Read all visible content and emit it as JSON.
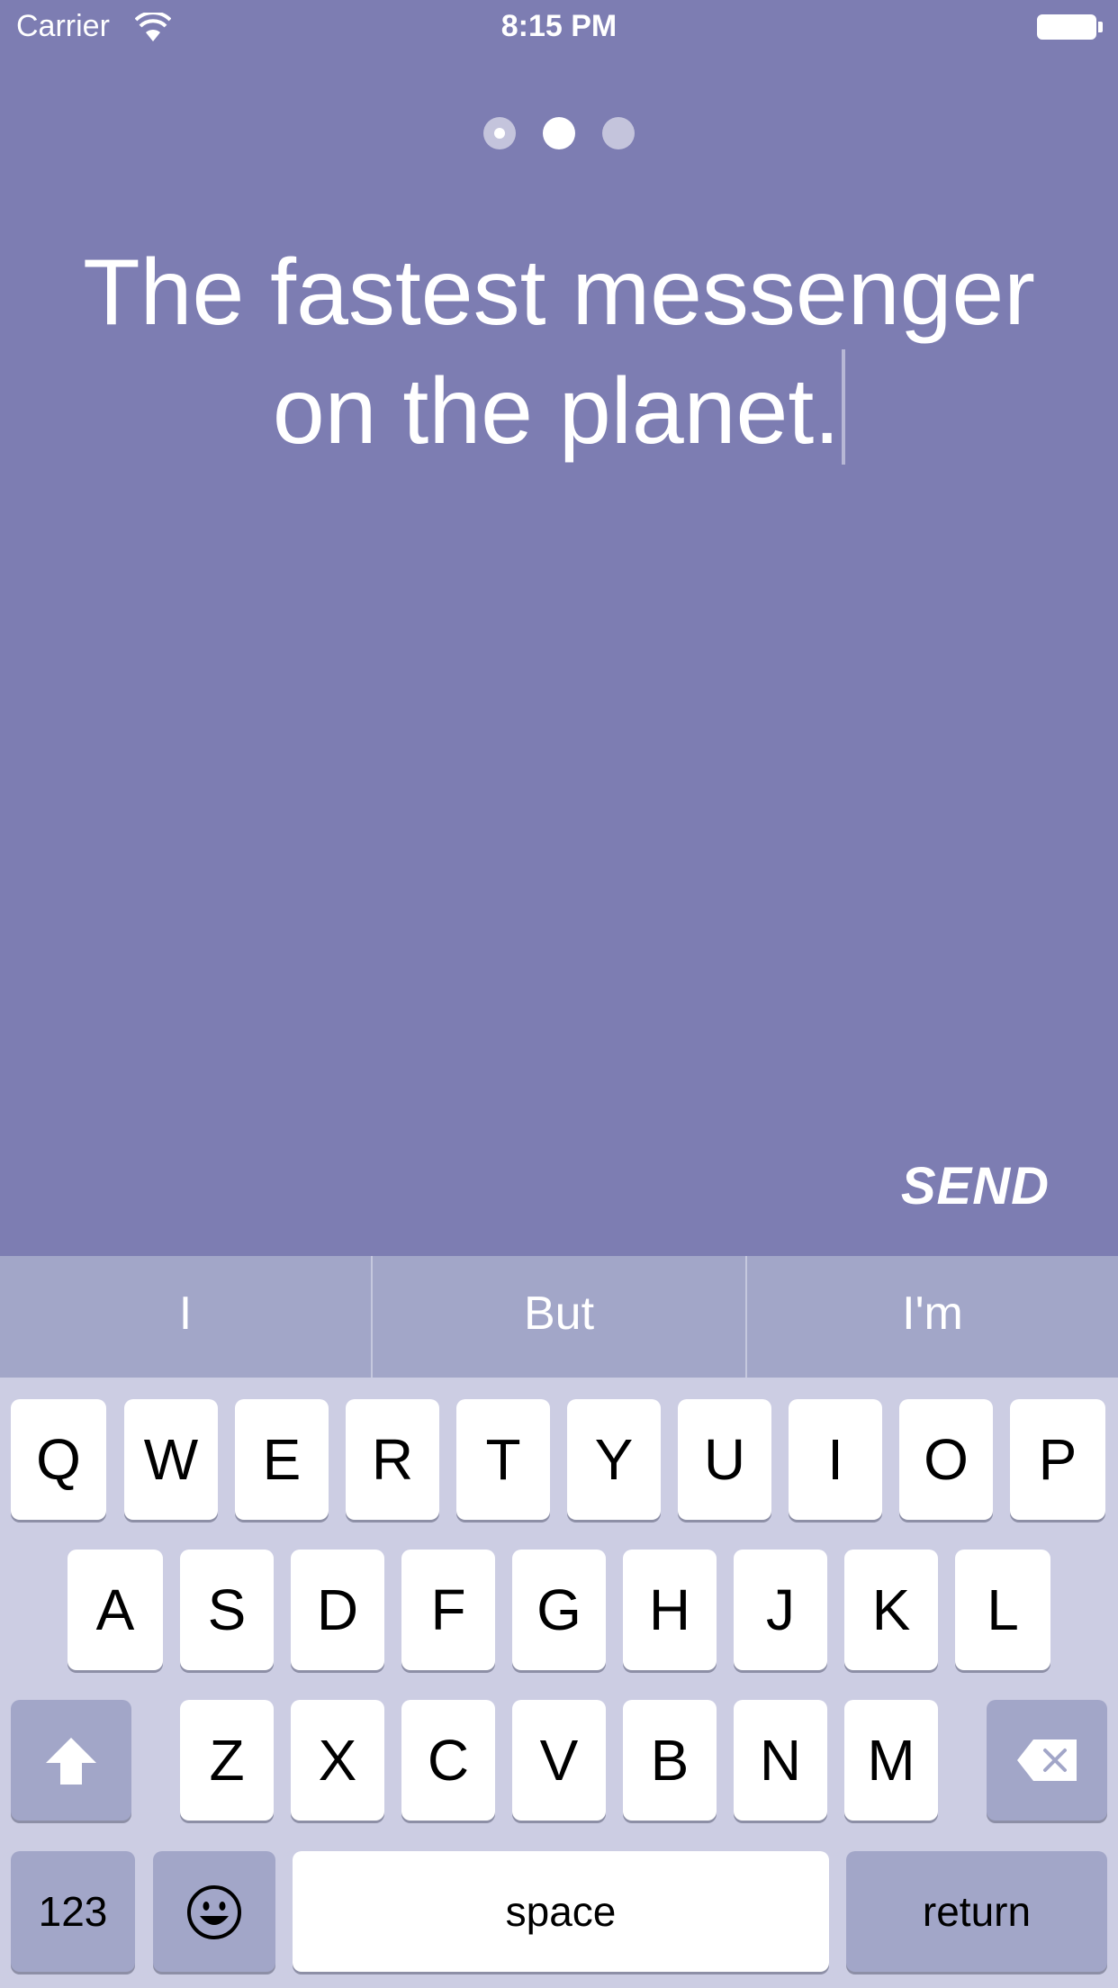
{
  "status_bar": {
    "carrier": "Carrier",
    "time": "8:15 PM"
  },
  "pager": {
    "page_count": 3,
    "current_page": 2
  },
  "headline": {
    "line1": "The fastest messenger",
    "line2": "on the planet."
  },
  "send_label": "SEND",
  "suggestions": [
    "I",
    "But",
    "I'm"
  ],
  "keyboard": {
    "row1": [
      "Q",
      "W",
      "E",
      "R",
      "T",
      "Y",
      "U",
      "I",
      "O",
      "P"
    ],
    "row2": [
      "A",
      "S",
      "D",
      "F",
      "G",
      "H",
      "J",
      "K",
      "L"
    ],
    "row3": [
      "Z",
      "X",
      "C",
      "V",
      "B",
      "N",
      "M"
    ],
    "numbers_label": "123",
    "space_label": "space",
    "return_label": "return",
    "shift_icon": "shift-arrow-up-icon",
    "delete_icon": "backspace-icon",
    "emoji_icon": "emoji-smiley-icon"
  },
  "colors": {
    "background": "#7d7db2",
    "suggestion_bar": "#a2a6c8",
    "keyboard": "#cccde3"
  }
}
